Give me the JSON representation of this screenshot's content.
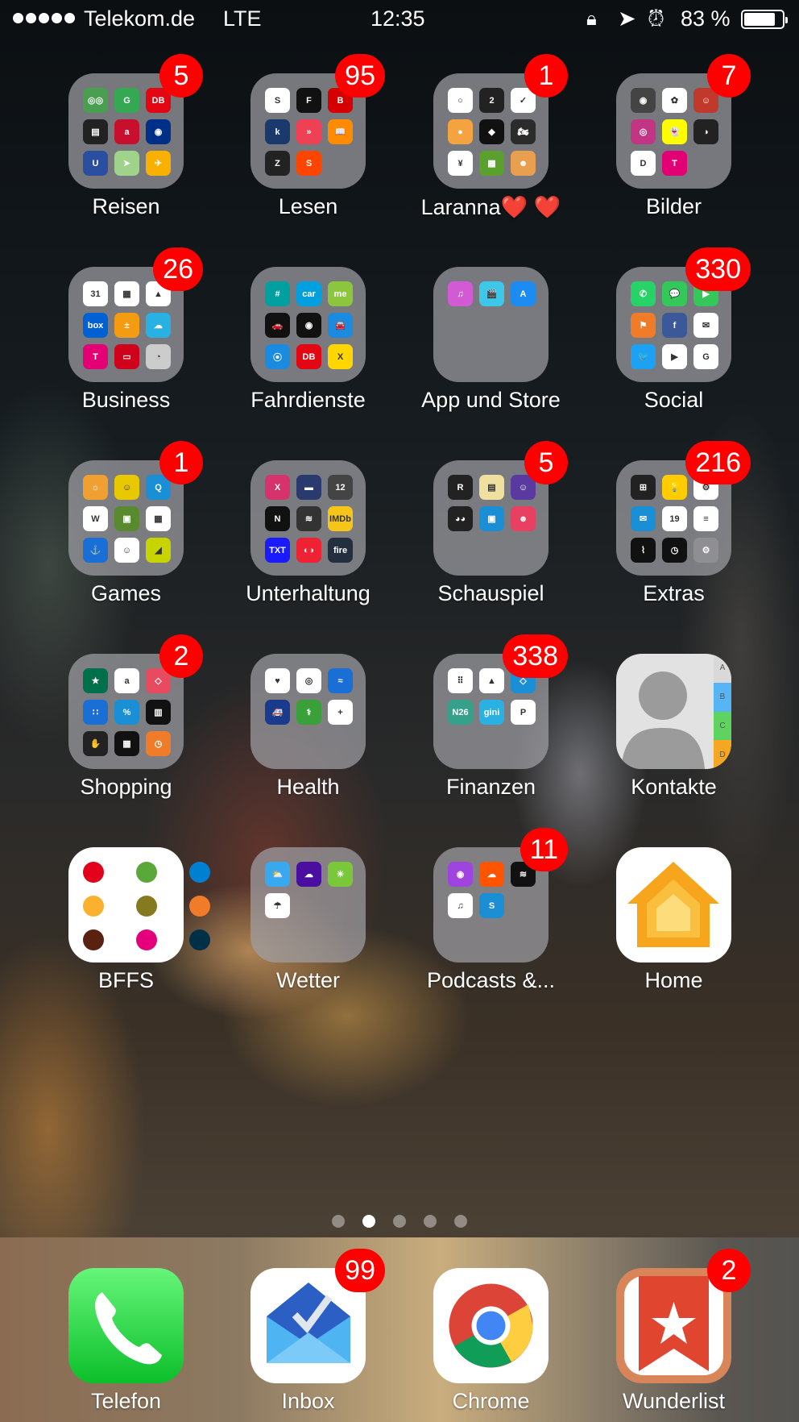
{
  "status_bar": {
    "carrier": "Telekom.de",
    "network": "LTE",
    "time": "12:35",
    "battery_percent_label": "83 %",
    "battery_level": 0.83,
    "signal_bars": 5,
    "icons": [
      "orientation-lock-icon",
      "location-arrow-icon",
      "alarm-clock-icon"
    ]
  },
  "grid": [
    {
      "label": "Reisen",
      "type": "folder",
      "badge": "5",
      "apps": [
        {
          "name": "tripadvisor",
          "color": "#4a9e4f",
          "glyph": "◎◎"
        },
        {
          "name": "google-maps",
          "color": "#34a853",
          "glyph": "G"
        },
        {
          "name": "db-navigator",
          "color": "#e30613",
          "glyph": "DB"
        },
        {
          "name": "wallet",
          "color": "#222222",
          "glyph": "▤"
        },
        {
          "name": "airberlin",
          "color": "#c8102e",
          "glyph": "a"
        },
        {
          "name": "opodo",
          "color": "#002f87",
          "glyph": "◉"
        },
        {
          "name": "fahrinfo",
          "color": "#2a4fa0",
          "glyph": "U"
        },
        {
          "name": "apple-maps",
          "color": "#9fd28a",
          "glyph": "➤"
        },
        {
          "name": "lufthansa",
          "color": "#f9b000",
          "glyph": "✈"
        }
      ]
    },
    {
      "label": "Lesen",
      "type": "folder",
      "badge": "95",
      "apps": [
        {
          "name": "spiegel-online",
          "color": "#ffffff",
          "glyph": "S"
        },
        {
          "name": "faz",
          "color": "#111111",
          "glyph": "F"
        },
        {
          "name": "bild",
          "color": "#d50000",
          "glyph": "B"
        },
        {
          "name": "kindle",
          "color": "#1a3a6e",
          "glyph": "k"
        },
        {
          "name": "pocket-feed",
          "color": "#ef4056",
          "glyph": "»"
        },
        {
          "name": "ibooks",
          "color": "#ff8c00",
          "glyph": "📖"
        },
        {
          "name": "zeit",
          "color": "#222222",
          "glyph": "Z"
        },
        {
          "name": "s-news",
          "color": "#ff4500",
          "glyph": "S"
        }
      ]
    },
    {
      "label": "Laranna❤️ ❤️",
      "type": "folder",
      "badge": "1",
      "apps": [
        {
          "name": "app-1",
          "color": "#ffffff",
          "glyph": "○"
        },
        {
          "name": "app-2",
          "color": "#222222",
          "glyph": "2"
        },
        {
          "name": "nike",
          "color": "#ffffff",
          "glyph": "✓"
        },
        {
          "name": "app-4",
          "color": "#f4a340",
          "glyph": "●"
        },
        {
          "name": "app-5",
          "color": "#111111",
          "glyph": "◆"
        },
        {
          "name": "app-6",
          "color": "#2b2b2b",
          "glyph": "🏍"
        },
        {
          "name": "app-7",
          "color": "#ffffff",
          "glyph": "¥"
        },
        {
          "name": "app-8",
          "color": "#5aa02c",
          "glyph": "▦"
        },
        {
          "name": "app-9",
          "color": "#e8a050",
          "glyph": "☻"
        }
      ]
    },
    {
      "label": "Bilder",
      "type": "folder",
      "badge": "7",
      "apps": [
        {
          "name": "camera",
          "color": "#444444",
          "glyph": "◉"
        },
        {
          "name": "photos",
          "color": "#ffffff",
          "glyph": "✿"
        },
        {
          "name": "app-3",
          "color": "#c0392b",
          "glyph": "☺"
        },
        {
          "name": "instagram",
          "color": "#c13584",
          "glyph": "◎"
        },
        {
          "name": "snapchat",
          "color": "#fffc00",
          "glyph": "👻"
        },
        {
          "name": "app-6",
          "color": "#222222",
          "glyph": "◑"
        },
        {
          "name": "app-7",
          "color": "#ffffff",
          "glyph": "D"
        },
        {
          "name": "app-8",
          "color": "#e20074",
          "glyph": "T"
        }
      ]
    },
    {
      "label": "Business",
      "type": "folder",
      "badge": "26",
      "apps": [
        {
          "name": "calendar",
          "color": "#ffffff",
          "glyph": "31"
        },
        {
          "name": "trello",
          "color": "#ffffff",
          "glyph": "▦"
        },
        {
          "name": "google-drive",
          "color": "#ffffff",
          "glyph": "▲"
        },
        {
          "name": "box",
          "color": "#0061d5",
          "glyph": "box"
        },
        {
          "name": "calculator",
          "color": "#f39c12",
          "glyph": "±"
        },
        {
          "name": "cloud",
          "color": "#2ab1e4",
          "glyph": "☁"
        },
        {
          "name": "telekom",
          "color": "#e20074",
          "glyph": "T"
        },
        {
          "name": "app-8",
          "color": "#d0021b",
          "glyph": "▭"
        },
        {
          "name": "app-9",
          "color": "#cccccc",
          "glyph": "◔"
        }
      ]
    },
    {
      "label": "Fahrdienste",
      "type": "folder",
      "badge": null,
      "apps": [
        {
          "name": "app-1",
          "color": "#00a0a0",
          "glyph": "#"
        },
        {
          "name": "car2go",
          "color": "#00a0df",
          "glyph": "car"
        },
        {
          "name": "mobility",
          "color": "#8cc63f",
          "glyph": "me"
        },
        {
          "name": "app-4",
          "color": "#111111",
          "glyph": "🚗"
        },
        {
          "name": "uber",
          "color": "#111111",
          "glyph": "◉"
        },
        {
          "name": "app-6",
          "color": "#1b8be0",
          "glyph": "🚘"
        },
        {
          "name": "app-7",
          "color": "#1b8be0",
          "glyph": "⦿"
        },
        {
          "name": "db-call-a-bike",
          "color": "#e30613",
          "glyph": "DB"
        },
        {
          "name": "app-9",
          "color": "#ffd600",
          "glyph": "X"
        }
      ]
    },
    {
      "label": "App und Store",
      "type": "folder",
      "badge": null,
      "apps": [
        {
          "name": "itunes-store",
          "color": "#d25bd5",
          "glyph": "♫"
        },
        {
          "name": "clips",
          "color": "#3dc7e8",
          "glyph": "🎬"
        },
        {
          "name": "app-store",
          "color": "#1c8cf3",
          "glyph": "A"
        }
      ]
    },
    {
      "label": "Social",
      "type": "folder",
      "badge": "330",
      "apps": [
        {
          "name": "whatsapp",
          "color": "#25d366",
          "glyph": "✆"
        },
        {
          "name": "messages",
          "color": "#34c759",
          "glyph": "💬"
        },
        {
          "name": "facetime",
          "color": "#34c759",
          "glyph": "▶"
        },
        {
          "name": "app-4",
          "color": "#f07b28",
          "glyph": "⚑"
        },
        {
          "name": "facebook",
          "color": "#3b5998",
          "glyph": "f"
        },
        {
          "name": "messenger",
          "color": "#ffffff",
          "glyph": "✉"
        },
        {
          "name": "twitter",
          "color": "#1da1f2",
          "glyph": "🐦"
        },
        {
          "name": "youtube",
          "color": "#ffffff",
          "glyph": "▶"
        },
        {
          "name": "google",
          "color": "#ffffff",
          "glyph": "G"
        }
      ]
    },
    {
      "label": "Games",
      "type": "folder",
      "badge": "1",
      "apps": [
        {
          "name": "app-1",
          "color": "#f0a030",
          "glyph": "☼"
        },
        {
          "name": "app-2",
          "color": "#e8c800",
          "glyph": "☺"
        },
        {
          "name": "quizduell",
          "color": "#1a8fd6",
          "glyph": "Q"
        },
        {
          "name": "wordgod",
          "color": "#ffffff",
          "glyph": "W"
        },
        {
          "name": "app-5",
          "color": "#5a8a30",
          "glyph": "▣"
        },
        {
          "name": "app-6",
          "color": "#ffffff",
          "glyph": "▦"
        },
        {
          "name": "app-7",
          "color": "#1a6fd6",
          "glyph": "⚓"
        },
        {
          "name": "app-8",
          "color": "#ffffff",
          "glyph": "☺"
        },
        {
          "name": "app-9",
          "color": "#c8d400",
          "glyph": "◢"
        }
      ]
    },
    {
      "label": "Unterhaltung",
      "type": "folder",
      "badge": null,
      "apps": [
        {
          "name": "app-1",
          "color": "#d6336c",
          "glyph": "X"
        },
        {
          "name": "app-2",
          "color": "#2a3a6e",
          "glyph": "▬"
        },
        {
          "name": "app-3",
          "color": "#444444",
          "glyph": "12"
        },
        {
          "name": "netflix",
          "color": "#111111",
          "glyph": "N"
        },
        {
          "name": "app-5",
          "color": "#333333",
          "glyph": "≋"
        },
        {
          "name": "imdb",
          "color": "#f5c518",
          "glyph": "IMDb"
        },
        {
          "name": "txt",
          "color": "#1a1aff",
          "glyph": "TXT"
        },
        {
          "name": "app-8",
          "color": "#e23",
          "glyph": "◐◑"
        },
        {
          "name": "amazon-fire-tv",
          "color": "#232f3e",
          "glyph": "fire"
        }
      ]
    },
    {
      "label": "Schauspiel",
      "type": "folder",
      "badge": "5",
      "apps": [
        {
          "name": "app-1",
          "color": "#222222",
          "glyph": "R"
        },
        {
          "name": "app-2",
          "color": "#f0e0a0",
          "glyph": "▤"
        },
        {
          "name": "app-3",
          "color": "#5a3aa0",
          "glyph": "☺"
        },
        {
          "name": "app-4",
          "color": "#222222",
          "glyph": "◕◕"
        },
        {
          "name": "app-5",
          "color": "#1a8fd6",
          "glyph": "▣"
        },
        {
          "name": "app-6",
          "color": "#e84060",
          "glyph": "☻"
        }
      ]
    },
    {
      "label": "Extras",
      "type": "folder",
      "badge": "216",
      "apps": [
        {
          "name": "app-1",
          "color": "#222222",
          "glyph": "⊞"
        },
        {
          "name": "tips",
          "color": "#ffcc00",
          "glyph": "💡"
        },
        {
          "name": "app-3",
          "color": "#ffffff",
          "glyph": "⚙"
        },
        {
          "name": "mail",
          "color": "#1a8fd6",
          "glyph": "✉"
        },
        {
          "name": "calendar",
          "color": "#ffffff",
          "glyph": "19"
        },
        {
          "name": "reminders",
          "color": "#ffffff",
          "glyph": "≡"
        },
        {
          "name": "stocks",
          "color": "#111111",
          "glyph": "⌇"
        },
        {
          "name": "clock",
          "color": "#111111",
          "glyph": "◷"
        },
        {
          "name": "settings",
          "color": "#8e8e93",
          "glyph": "⚙"
        }
      ]
    },
    {
      "label": "Shopping",
      "type": "folder",
      "badge": "2",
      "apps": [
        {
          "name": "starbucks",
          "color": "#00704a",
          "glyph": "★"
        },
        {
          "name": "amazon",
          "color": "#ffffff",
          "glyph": "a"
        },
        {
          "name": "app-3",
          "color": "#e84a5f",
          "glyph": "◇"
        },
        {
          "name": "app-4",
          "color": "#1a6fd6",
          "glyph": "∷"
        },
        {
          "name": "app-5",
          "color": "#1a8fd6",
          "glyph": "%"
        },
        {
          "name": "app-6",
          "color": "#111111",
          "glyph": "▥"
        },
        {
          "name": "app-7",
          "color": "#222222",
          "glyph": "✋"
        },
        {
          "name": "app-8",
          "color": "#111111",
          "glyph": "▦"
        },
        {
          "name": "app-9",
          "color": "#f07b28",
          "glyph": "◷"
        }
      ]
    },
    {
      "label": "Health",
      "type": "folder",
      "badge": null,
      "apps": [
        {
          "name": "health",
          "color": "#ffffff",
          "glyph": "♥"
        },
        {
          "name": "activity",
          "color": "#ffffff",
          "glyph": "◎"
        },
        {
          "name": "app-3",
          "color": "#1a6fd6",
          "glyph": "≈"
        },
        {
          "name": "app-4",
          "color": "#1a3a8e",
          "glyph": "🚑"
        },
        {
          "name": "app-5",
          "color": "#3aa03a",
          "glyph": "⚕"
        },
        {
          "name": "app-6",
          "color": "#ffffff",
          "glyph": "+"
        }
      ]
    },
    {
      "label": "Finanzen",
      "type": "folder",
      "badge": "338",
      "apps": [
        {
          "name": "app-1",
          "color": "#ffffff",
          "glyph": "⠿"
        },
        {
          "name": "google-drive",
          "color": "#ffffff",
          "glyph": "▲"
        },
        {
          "name": "app-3",
          "color": "#1a8fd6",
          "glyph": "◇"
        },
        {
          "name": "n26",
          "color": "#36a18b",
          "glyph": "N26"
        },
        {
          "name": "gini",
          "color": "#2ab1e4",
          "glyph": "gini"
        },
        {
          "name": "paypal",
          "color": "#ffffff",
          "glyph": "P"
        }
      ]
    },
    {
      "label": "Kontakte",
      "type": "app",
      "icon": "contacts",
      "badge": null,
      "tabs": [
        "A",
        "B",
        "C",
        "D"
      ]
    },
    {
      "label": "BFFS",
      "type": "app",
      "icon": "bffs",
      "badge": null,
      "dots": [
        "#e2001a",
        "#5aa83a",
        "#0080d0",
        "#fbb030",
        "#857a20",
        "#f07b28",
        "#5a2010",
        "#e4007a",
        "#003048"
      ]
    },
    {
      "label": "Wetter",
      "type": "folder",
      "badge": null,
      "apps": [
        {
          "name": "weather",
          "color": "#3aa8ee",
          "glyph": "⛅"
        },
        {
          "name": "yahoo-weather",
          "color": "#4a0ea0",
          "glyph": "☁"
        },
        {
          "name": "app-3",
          "color": "#7ac83a",
          "glyph": "☀"
        },
        {
          "name": "rain-radar",
          "color": "#ffffff",
          "glyph": "☂"
        }
      ]
    },
    {
      "label": "Podcasts &...",
      "type": "folder",
      "badge": "11",
      "apps": [
        {
          "name": "podcasts",
          "color": "#a044e0",
          "glyph": "◉"
        },
        {
          "name": "soundcloud",
          "color": "#ff5500",
          "glyph": "☁"
        },
        {
          "name": "spotify",
          "color": "#111111",
          "glyph": "≋"
        },
        {
          "name": "music",
          "color": "#ffffff",
          "glyph": "♫"
        },
        {
          "name": "shazam",
          "color": "#1a8fd6",
          "glyph": "S"
        }
      ]
    },
    {
      "label": "Home",
      "type": "app",
      "icon": "home",
      "badge": null
    }
  ],
  "page_indicator": {
    "count": 5,
    "active_index": 1
  },
  "dock": [
    {
      "label": "Telefon",
      "icon": "phone",
      "badge": null
    },
    {
      "label": "Inbox",
      "icon": "inbox",
      "badge": "99"
    },
    {
      "label": "Chrome",
      "icon": "chrome",
      "badge": null
    },
    {
      "label": "Wunderlist",
      "icon": "wunderlist",
      "badge": "2"
    }
  ]
}
